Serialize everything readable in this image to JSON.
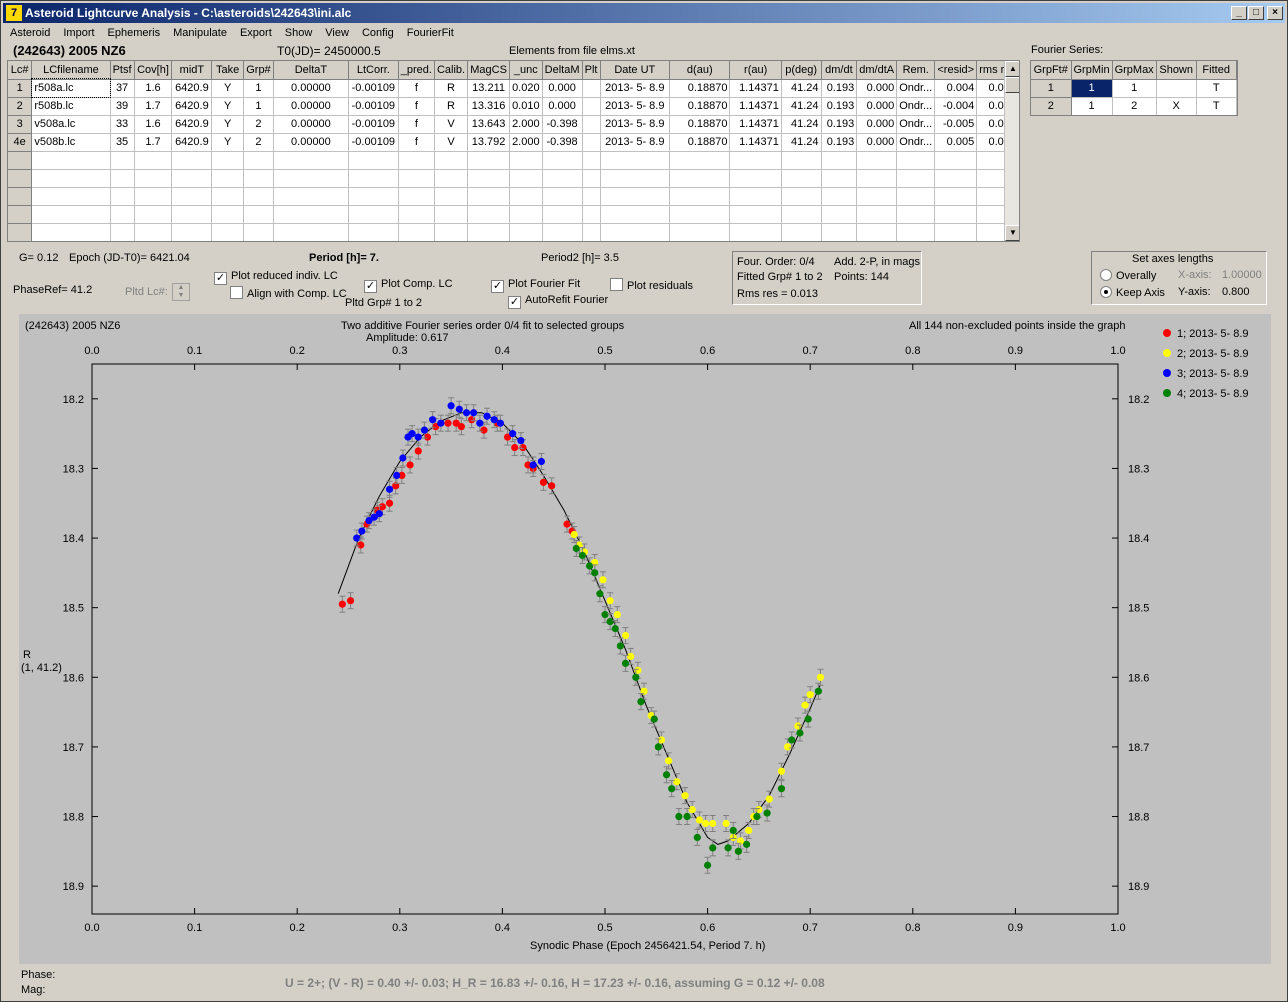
{
  "window": {
    "title": "Asteroid Lightcurve Analysis - C:\\asteroids\\242643\\ini.alc",
    "icon": "app-icon"
  },
  "menu": [
    "Asteroid",
    "Import",
    "Ephemeris",
    "Manipulate",
    "Export",
    "Show",
    "View",
    "Config",
    "FourierFit"
  ],
  "header": {
    "object": "(242643) 2005 NZ6",
    "t0": "T0(JD)= 2450000.5",
    "elements": "Elements from file elms.xt",
    "fourier_series_label": "Fourier Series:"
  },
  "lc_table": {
    "columns": [
      "Lc#",
      "LCfilename",
      "Ptsf",
      "Cov[h]",
      "midT",
      "Take",
      "Grp#",
      "DeltaT",
      "LtCorr.",
      "_pred.",
      "Calib.",
      "MagCS",
      "_unc",
      "DeltaM",
      "Plt",
      "Date UT",
      "d(au)",
      "r(au)",
      "p(deg)",
      "dm/dt",
      "dm/dtA",
      "Rem.",
      "<resid>",
      "rms res"
    ],
    "rows": [
      [
        "1",
        "r508a.lc",
        "37",
        "1.6",
        "6420.9",
        "Y",
        "1",
        "0.00000",
        "-0.00109",
        "f",
        "R",
        "13.211",
        "0.020",
        "0.000",
        "",
        "2013- 5- 8.9",
        "0.18870",
        "1.14371",
        "41.24",
        "0.193",
        "0.000",
        "Ondr...",
        "0.004",
        "0.012"
      ],
      [
        "2",
        "r508b.lc",
        "39",
        "1.7",
        "6420.9",
        "Y",
        "1",
        "0.00000",
        "-0.00109",
        "f",
        "R",
        "13.316",
        "0.010",
        "0.000",
        "",
        "2013- 5- 8.9",
        "0.18870",
        "1.14371",
        "41.24",
        "0.193",
        "0.000",
        "Ondr...",
        "-0.004",
        "0.012"
      ],
      [
        "3",
        "v508a.lc",
        "33",
        "1.6",
        "6420.9",
        "Y",
        "2",
        "0.00000",
        "-0.00109",
        "f",
        "V",
        "13.643",
        "2.000",
        "-0.398",
        "",
        "2013- 5- 8.9",
        "0.18870",
        "1.14371",
        "41.24",
        "0.193",
        "0.000",
        "Ondr...",
        "-0.005",
        "0.012"
      ],
      [
        "4e",
        "v508b.lc",
        "35",
        "1.7",
        "6420.9",
        "Y",
        "2",
        "0.00000",
        "-0.00109",
        "f",
        "V",
        "13.792",
        "2.000",
        "-0.398",
        "",
        "2013- 5- 8.9",
        "0.18870",
        "1.14371",
        "41.24",
        "0.193",
        "0.000",
        "Ondr...",
        "0.005",
        "0.013"
      ]
    ]
  },
  "fourier_table": {
    "columns": [
      "GrpFt#",
      "GrpMin",
      "GrpMax",
      "Shown",
      "Fitted"
    ],
    "rows": [
      [
        "1",
        "1",
        "1",
        "",
        "T"
      ],
      [
        "2",
        "1",
        "2",
        "X",
        "T"
      ]
    ]
  },
  "params": {
    "g": "G= 0.12",
    "epoch": "Epoch (JD-T0)= 6421.04",
    "period": "Period [h]= 7.",
    "period2": "Period2 [h]= 3.5",
    "phaseref": "PhaseRef= 41.2",
    "pltd_lc": "Pltd Lc#:",
    "plot_reduced": "Plot reduced indiv. LC",
    "align_comp": "Align with Comp. LC",
    "plot_comp": "Plot Comp. LC",
    "pltd_grp": "Pltd Grp#  1   to   2",
    "plot_fourier": "Plot Fourier Fit",
    "autorefit": "AutoRefit Fourier",
    "plot_residuals": "Plot residuals"
  },
  "fit_info": {
    "order": "Four. Order:  0/4",
    "add": "Add. 2-P, in mags",
    "fitted": "Fitted Grp# 1 to 2",
    "points": "Points: 144",
    "rms": "Rms res      = 0.013"
  },
  "axes_box": {
    "title": "Set axes lengths",
    "overally": "Overally",
    "keep_axis": "Keep Axis",
    "x_label": "X-axis:",
    "x_value": "1.00000",
    "y_label": "Y-axis:",
    "y_value": "0.800"
  },
  "plot": {
    "object": "(242643) 2005 NZ6",
    "subtitle": "Two additive Fourier series order 0/4 fit to selected groups",
    "amplitude": "Amplitude: 0.617",
    "note": "All 144 non-excluded points inside the graph",
    "ylabel_1": "R",
    "ylabel_2": "(1, 41.2)",
    "xlabel": "Synodic Phase (Epoch 2456421.54, Period 7. h)",
    "phase_label": "Phase:",
    "mag_label": "Mag:",
    "status": "U = 2+; (V - R) = 0.40 +/- 0.03; H_R = 16.83 +/- 0.16, H = 17.23 +/- 0.16, assuming G = 0.12 +/- 0.08"
  },
  "chart_data": {
    "type": "scatter",
    "xlim": [
      0.0,
      1.0
    ],
    "ylim": [
      18.15,
      18.94
    ],
    "y_inverted": true,
    "x_ticks": [
      "0.0",
      "0.1",
      "0.2",
      "0.3",
      "0.4",
      "0.5",
      "0.6",
      "0.7",
      "0.8",
      "0.9",
      "1.0"
    ],
    "y_ticks": [
      "18.2",
      "18.3",
      "18.4",
      "18.5",
      "18.6",
      "18.7",
      "18.8",
      "18.9"
    ],
    "grid": false,
    "legend_position": "right",
    "series": [
      {
        "name": "1; 2013- 5- 8.9",
        "color": "#ff0000",
        "x": [
          0.244,
          0.252,
          0.262,
          0.268,
          0.278,
          0.283,
          0.29,
          0.296,
          0.302,
          0.31,
          0.318,
          0.327,
          0.335,
          0.347,
          0.355,
          0.36,
          0.37,
          0.382,
          0.395,
          0.405,
          0.412,
          0.42,
          0.425,
          0.43,
          0.44,
          0.448,
          0.463,
          0.468
        ],
        "y": [
          18.495,
          18.49,
          18.41,
          18.38,
          18.36,
          18.355,
          18.35,
          18.325,
          18.31,
          18.295,
          18.275,
          18.255,
          18.24,
          18.235,
          18.235,
          18.24,
          18.23,
          18.245,
          18.235,
          18.255,
          18.27,
          18.27,
          18.295,
          18.3,
          18.32,
          18.325,
          18.38,
          18.39
        ]
      },
      {
        "name": "2; 2013- 5- 8.9",
        "color": "#ffff00",
        "x": [
          0.47,
          0.475,
          0.48,
          0.49,
          0.498,
          0.505,
          0.512,
          0.52,
          0.525,
          0.532,
          0.538,
          0.545,
          0.555,
          0.562,
          0.57,
          0.578,
          0.585,
          0.592,
          0.598,
          0.605,
          0.618,
          0.625,
          0.632,
          0.64,
          0.645,
          0.65,
          0.66,
          0.672,
          0.678,
          0.688,
          0.695,
          0.7,
          0.71
        ],
        "y": [
          18.395,
          18.41,
          18.42,
          18.435,
          18.46,
          18.49,
          18.51,
          18.54,
          18.57,
          18.59,
          18.62,
          18.655,
          18.69,
          18.72,
          18.75,
          18.77,
          18.79,
          18.805,
          18.81,
          18.81,
          18.81,
          18.83,
          18.835,
          18.82,
          18.8,
          18.79,
          18.775,
          18.735,
          18.7,
          18.67,
          18.64,
          18.625,
          18.6
        ]
      },
      {
        "name": "3; 2013- 5- 8.9",
        "color": "#0000ff",
        "x": [
          0.258,
          0.263,
          0.27,
          0.275,
          0.28,
          0.29,
          0.297,
          0.303,
          0.308,
          0.312,
          0.318,
          0.324,
          0.332,
          0.34,
          0.35,
          0.358,
          0.365,
          0.372,
          0.378,
          0.385,
          0.392,
          0.398,
          0.41,
          0.418,
          0.43,
          0.438
        ],
        "y": [
          18.4,
          18.39,
          18.375,
          18.37,
          18.365,
          18.33,
          18.31,
          18.285,
          18.255,
          18.25,
          18.255,
          18.245,
          18.23,
          18.235,
          18.21,
          18.215,
          18.22,
          18.22,
          18.235,
          18.225,
          18.23,
          18.235,
          18.25,
          18.26,
          18.295,
          18.29
        ]
      },
      {
        "name": "4; 2013- 5- 8.9",
        "color": "#008000",
        "x": [
          0.472,
          0.478,
          0.485,
          0.49,
          0.495,
          0.5,
          0.505,
          0.51,
          0.515,
          0.52,
          0.53,
          0.535,
          0.548,
          0.552,
          0.56,
          0.565,
          0.572,
          0.58,
          0.59,
          0.6,
          0.605,
          0.62,
          0.625,
          0.63,
          0.638,
          0.648,
          0.658,
          0.672,
          0.682,
          0.69,
          0.698,
          0.708
        ],
        "y": [
          18.415,
          18.425,
          18.44,
          18.45,
          18.48,
          18.51,
          18.52,
          18.53,
          18.555,
          18.58,
          18.6,
          18.635,
          18.66,
          18.7,
          18.74,
          18.76,
          18.8,
          18.8,
          18.83,
          18.87,
          18.845,
          18.845,
          18.82,
          18.85,
          18.84,
          18.8,
          18.795,
          18.76,
          18.69,
          18.68,
          18.66,
          18.62
        ]
      }
    ],
    "fit_curve": {
      "x": [
        0.24,
        0.26,
        0.28,
        0.3,
        0.32,
        0.34,
        0.36,
        0.38,
        0.4,
        0.42,
        0.44,
        0.46,
        0.48,
        0.5,
        0.52,
        0.54,
        0.56,
        0.58,
        0.6,
        0.61,
        0.62,
        0.64,
        0.66,
        0.68,
        0.7,
        0.71
      ],
      "y": [
        18.48,
        18.4,
        18.34,
        18.29,
        18.255,
        18.232,
        18.22,
        18.22,
        18.235,
        18.265,
        18.31,
        18.36,
        18.42,
        18.49,
        18.56,
        18.64,
        18.71,
        18.78,
        18.83,
        18.84,
        18.835,
        18.81,
        18.77,
        18.71,
        18.645,
        18.61
      ]
    }
  }
}
